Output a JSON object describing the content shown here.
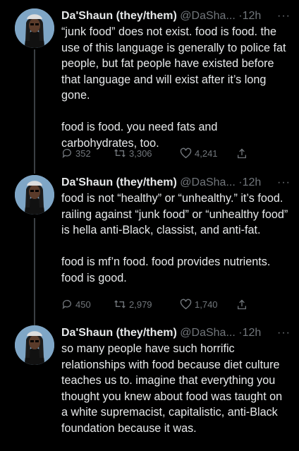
{
  "tweets": [
    {
      "name": "Da'Shaun (they/them)",
      "handle": "@DaSha...",
      "dot": "·",
      "time": "12h",
      "more": "···",
      "text": "“junk food” does not exist. food is food. the use of this language is generally to police fat people, but fat people have existed before that language and will exist after it’s long gone.\n\nfood is food. you need fats and carbohydrates, too.",
      "replies": "352",
      "retweets": "3,306",
      "likes": "4,241"
    },
    {
      "name": "Da'Shaun (they/them)",
      "handle": "@DaSha...",
      "dot": "·",
      "time": "12h",
      "more": "···",
      "text": "food is not “healthy” or “unhealthy.” it’s food. railing against “junk food” or “unhealthy food” is hella anti-Black, classist, and anti-fat.\n\nfood is mf’n food. food provides nutrients. food is good.",
      "replies": "450",
      "retweets": "2,979",
      "likes": "1,740"
    },
    {
      "name": "Da'Shaun (they/them)",
      "handle": "@DaSha...",
      "dot": "·",
      "time": "12h",
      "more": "···",
      "text": "so many people have such horrific relationships with food because diet culture teaches us to. imagine that everything you thought you knew about food was taught on a white supremacist, capitalistic, anti-Black foundation because it was."
    }
  ],
  "icons": {
    "reply": "reply-icon",
    "retweet": "retweet-icon",
    "like": "heart-icon",
    "share": "share-icon",
    "more": "more-icon"
  },
  "colors": {
    "background": "#000000",
    "text": "#e7e9ea",
    "muted": "#71767b",
    "thread_line": "#3a3f44",
    "avatar_bg": "#7fa6c6"
  }
}
